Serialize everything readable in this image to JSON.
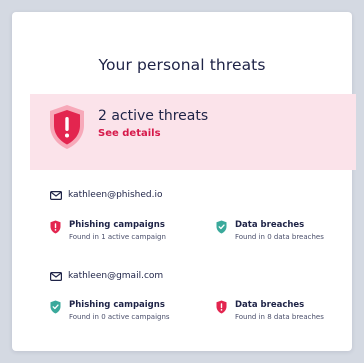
{
  "title": "Your personal threats",
  "alert": {
    "title": "2 active threats",
    "link": "See details"
  },
  "colors": {
    "danger": "#e3254f",
    "safe": "#3aa99b",
    "alert_bg": "#fbe3ea"
  },
  "accounts": [
    {
      "email": "kathleen@phished.io",
      "items": [
        {
          "name": "Phishing campaigns",
          "detail": "Found in 1 active campaign",
          "status": "danger",
          "icon": "alert-shield-icon"
        },
        {
          "name": "Data breaches",
          "detail": "Found in 0 data breaches",
          "status": "safe",
          "icon": "check-shield-icon"
        }
      ]
    },
    {
      "email": "kathleen@gmail.com",
      "items": [
        {
          "name": "Phishing campaigns",
          "detail": "Found in 0 active campaigns",
          "status": "safe",
          "icon": "check-shield-icon"
        },
        {
          "name": "Data breaches",
          "detail": "Found in 8 data breaches",
          "status": "danger",
          "icon": "alert-shield-icon"
        }
      ]
    }
  ]
}
